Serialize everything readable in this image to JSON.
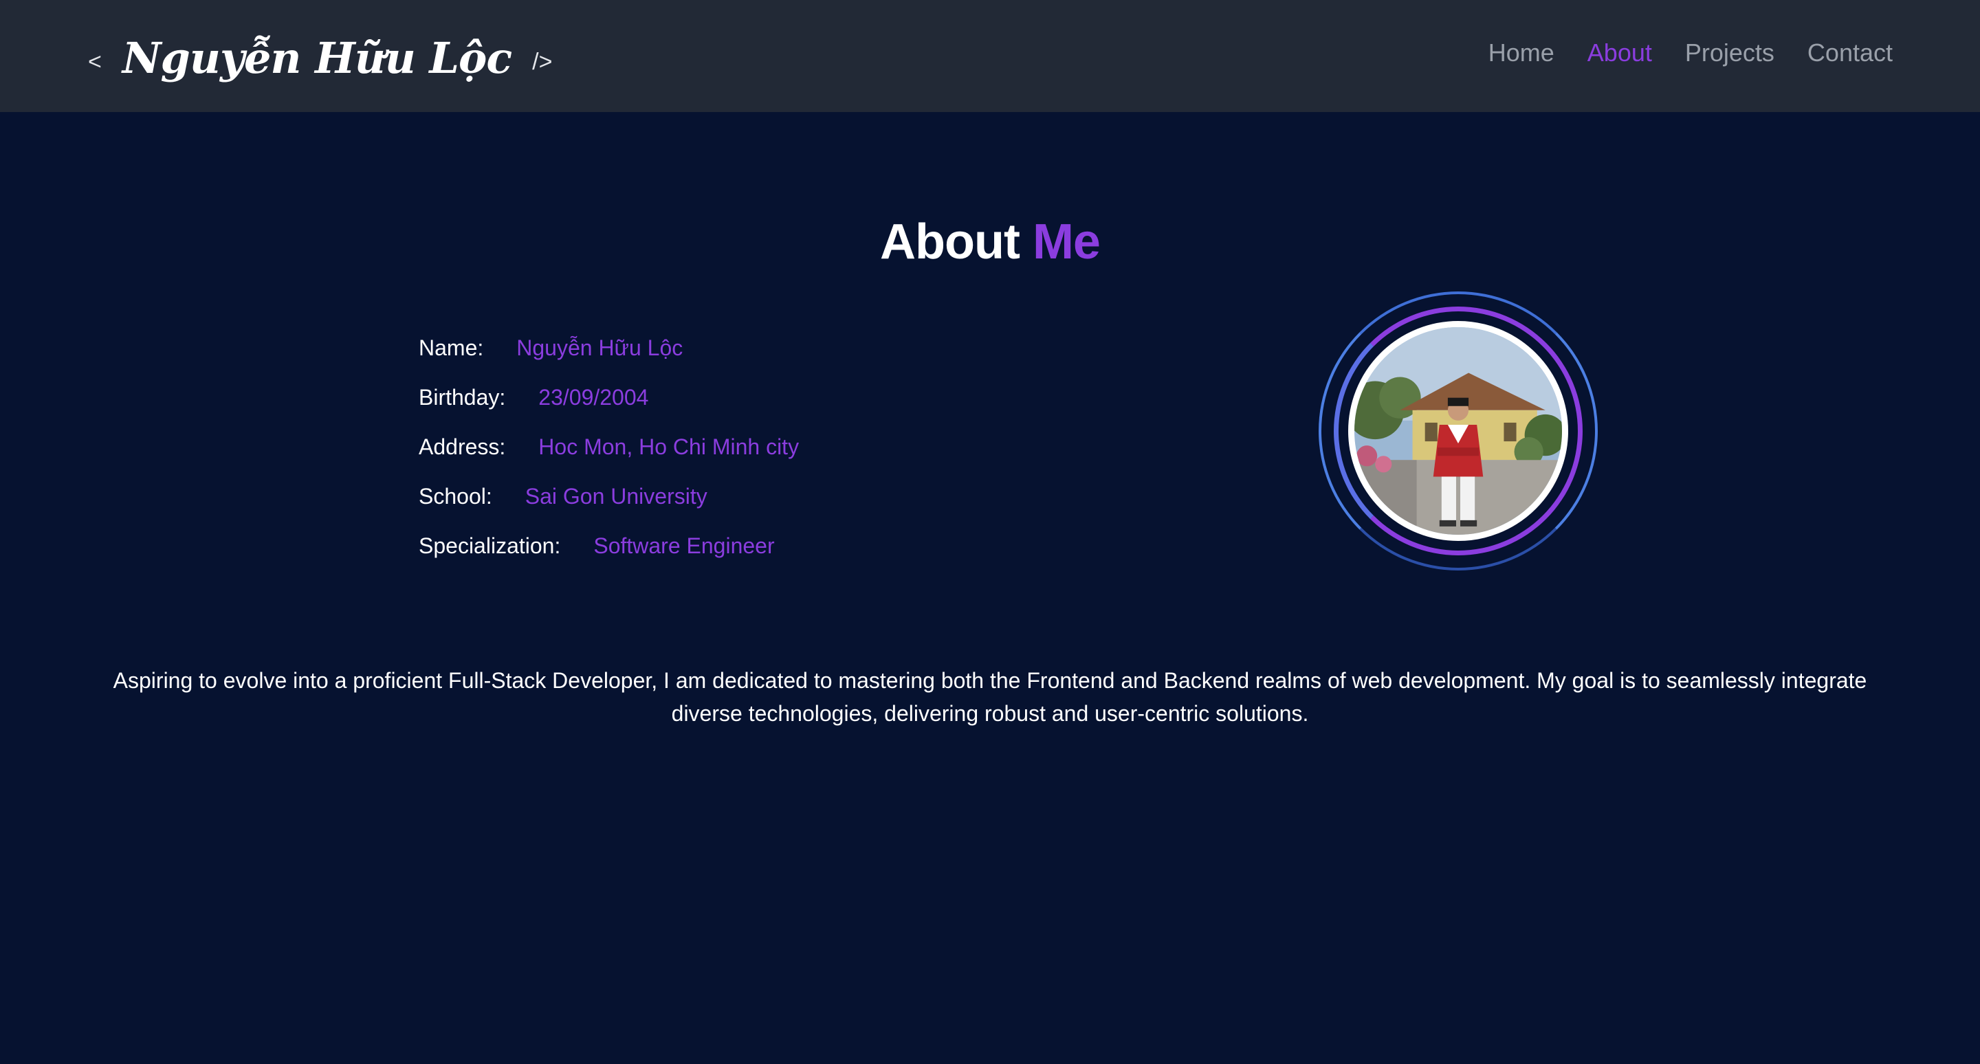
{
  "nav": {
    "logo": {
      "open_bracket": "<",
      "name": "Nguyễn Hữu Lộc",
      "close_bracket": "/>"
    },
    "links": [
      {
        "label": "Home",
        "active": false
      },
      {
        "label": "About",
        "active": true
      },
      {
        "label": "Projects",
        "active": false
      },
      {
        "label": "Contact",
        "active": false
      }
    ]
  },
  "about": {
    "title_main": "About",
    "title_accent": "Me",
    "info": [
      {
        "label": "Name:",
        "value": "Nguyễn Hữu Lộc"
      },
      {
        "label": "Birthday:",
        "value": "23/09/2004"
      },
      {
        "label": "Address:",
        "value": "Hoc Mon, Ho Chi Minh city"
      },
      {
        "label": "School:",
        "value": "Sai Gon University"
      },
      {
        "label": "Specialization:",
        "value": "Software Engineer"
      }
    ],
    "description": "Aspiring to evolve into a proficient Full-Stack Developer, I am dedicated to mastering both the Frontend and Backend realms of web development. My goal is to seamlessly integrate diverse technologies, delivering robust and user-centric solutions."
  },
  "colors": {
    "background": "#061230",
    "navbar": "#222936",
    "accent": "#8b3ddf",
    "nav_inactive": "#9aa0aa"
  }
}
